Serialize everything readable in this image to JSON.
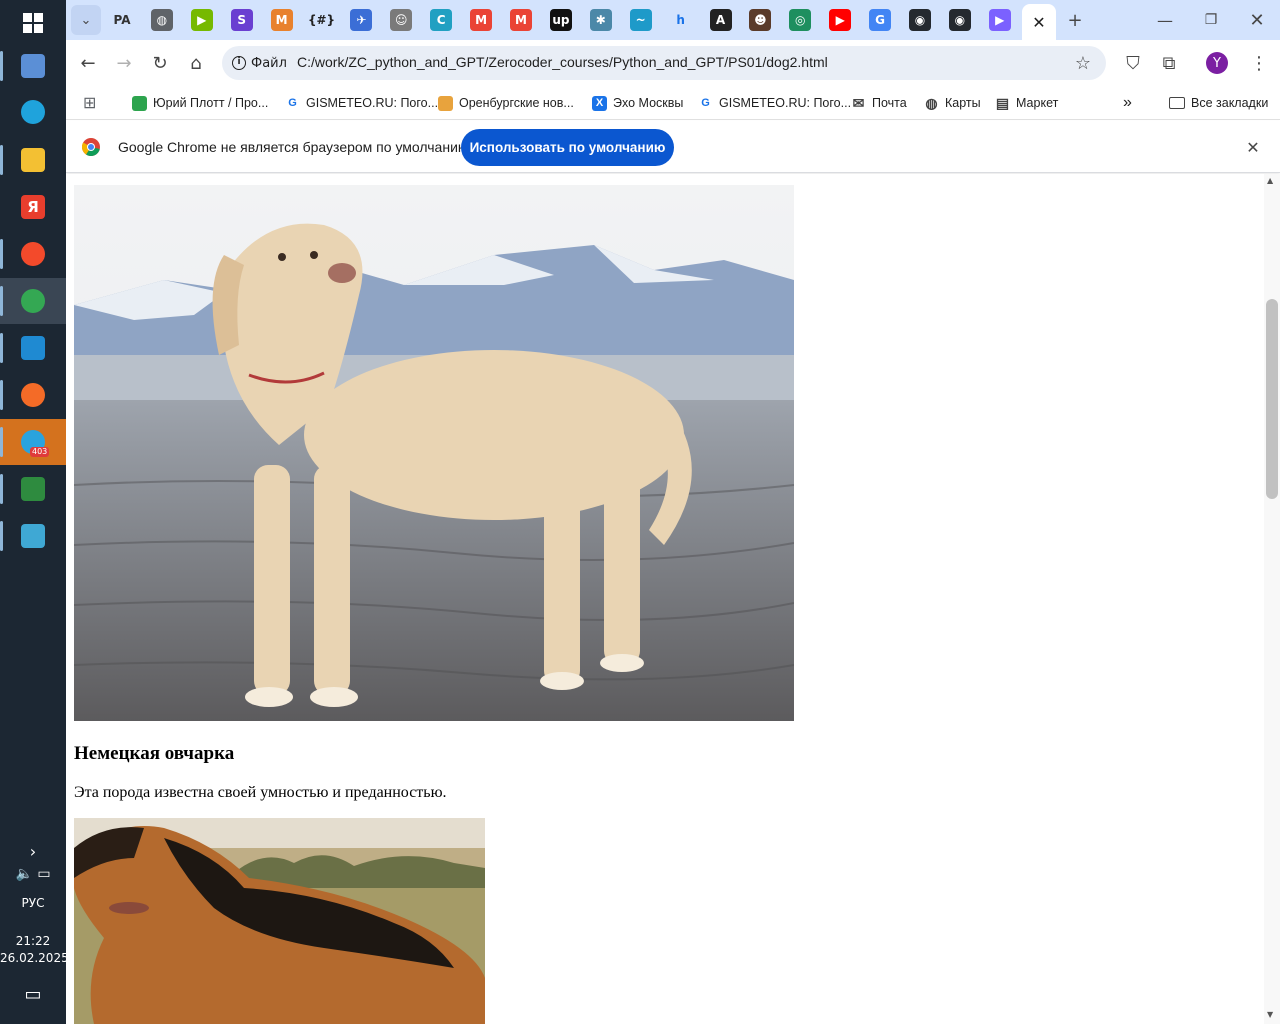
{
  "taskbar": {
    "apps": [
      {
        "name": "media-player-icon",
        "color": "#5b8fd6"
      },
      {
        "name": "edge-icon",
        "color": "#1fa3dc"
      },
      {
        "name": "file-explorer-icon",
        "color": "#f3c033"
      },
      {
        "name": "yandex-icon",
        "color": "#e83e2d",
        "glyph": "Я"
      },
      {
        "name": "yandex-browser-icon",
        "color": "#f34a2b"
      },
      {
        "name": "chrome-icon",
        "color": "#34a853"
      },
      {
        "name": "vscode-icon",
        "color": "#1f8ad2"
      },
      {
        "name": "firefox-icon",
        "color": "#f46b27"
      },
      {
        "name": "telegram-icon",
        "color": "#2aa3de",
        "badge": "403"
      },
      {
        "name": "spreadsheet-icon",
        "color": "#2e8b3f"
      },
      {
        "name": "app-bird-icon",
        "color": "#3fa8d4"
      }
    ],
    "language": "РУС",
    "time": "21:22",
    "date": "26.02.2025"
  },
  "browser": {
    "tabs": [
      {
        "name": "tab-pa",
        "glyph": "PA",
        "color": "#d3e3fd",
        "fg": "#333"
      },
      {
        "name": "tab-globe",
        "glyph": "◍",
        "color": "#5f6368"
      },
      {
        "name": "tab-nvidia",
        "glyph": "▶",
        "color": "#76b900"
      },
      {
        "name": "tab-s",
        "glyph": "S",
        "color": "#6a3fd1"
      },
      {
        "name": "tab-m",
        "glyph": "M",
        "color": "#e8812d"
      },
      {
        "name": "tab-regex",
        "glyph": "{#}",
        "color": "#d3e3fd",
        "fg": "#222"
      },
      {
        "name": "tab-bird",
        "glyph": "✈",
        "color": "#3b6ed6"
      },
      {
        "name": "tab-person",
        "glyph": "☺",
        "color": "#7a7a7a"
      },
      {
        "name": "tab-c",
        "glyph": "C",
        "color": "#21a0c2"
      },
      {
        "name": "tab-gmail",
        "glyph": "M",
        "color": "#ea4335"
      },
      {
        "name": "tab-gmail2",
        "glyph": "M",
        "color": "#ea4335"
      },
      {
        "name": "tab-up",
        "glyph": "up",
        "color": "#111"
      },
      {
        "name": "tab-star",
        "glyph": "✱",
        "color": "#4b88a8"
      },
      {
        "name": "tab-wave",
        "glyph": "~",
        "color": "#1e9ac9"
      },
      {
        "name": "tab-h",
        "glyph": "h",
        "color": "#d3e3fd",
        "fg": "#1a73e8"
      },
      {
        "name": "tab-a",
        "glyph": "A",
        "color": "#222"
      },
      {
        "name": "tab-portrait",
        "glyph": "☻",
        "color": "#5a3b2a"
      },
      {
        "name": "tab-circle",
        "glyph": "◎",
        "color": "#1e8f5f"
      },
      {
        "name": "tab-youtube",
        "glyph": "▶",
        "color": "#ff0000"
      },
      {
        "name": "tab-google",
        "glyph": "G",
        "color": "#4285f4"
      },
      {
        "name": "tab-github",
        "glyph": "◉",
        "color": "#24292f"
      },
      {
        "name": "tab-github2",
        "glyph": "◉",
        "color": "#24292f"
      },
      {
        "name": "tab-play",
        "glyph": "▶",
        "color": "#7b61ff"
      }
    ],
    "active_tab_close": "✕",
    "new_tab": "+",
    "url_chip": "Файл",
    "url": "C:/work/ZC_python_and_GPT/Zerocoder_courses/Python_and_GPT/PS01/dog2.html",
    "profile_initial": "Y",
    "bookmarks": [
      {
        "label": "Юрий Плотт / Про...",
        "color": "#2da44e",
        "glyph": ""
      },
      {
        "label": "GISMETEO.RU: Пого...",
        "color": "#ffffff",
        "glyph": "G",
        "fg": "#1a73e8"
      },
      {
        "label": "Оренбургские нов...",
        "color": "#e8a33d",
        "glyph": ""
      },
      {
        "label": "Эхо Москвы",
        "color": "#1a73e8",
        "glyph": "Х"
      },
      {
        "label": "GISMETEO.RU: Пого...",
        "color": "#ffffff",
        "glyph": "G",
        "fg": "#1a73e8"
      },
      {
        "label": "Почта",
        "color": "#5f6368",
        "glyph": "✉"
      },
      {
        "label": "Карты",
        "color": "#5f6368",
        "glyph": "◍"
      },
      {
        "label": "Маркет",
        "color": "#5f6368",
        "glyph": "▤"
      }
    ],
    "all_bookmarks": "Все закладки",
    "infobar_message": "Google Chrome не является браузером по умолчанию.",
    "infobar_button": "Использовать по умолчанию"
  },
  "page": {
    "breeds": [
      {
        "title": "Немецкая овчарка",
        "description": "Эта порода известна своей умностью и преданностью."
      }
    ]
  }
}
